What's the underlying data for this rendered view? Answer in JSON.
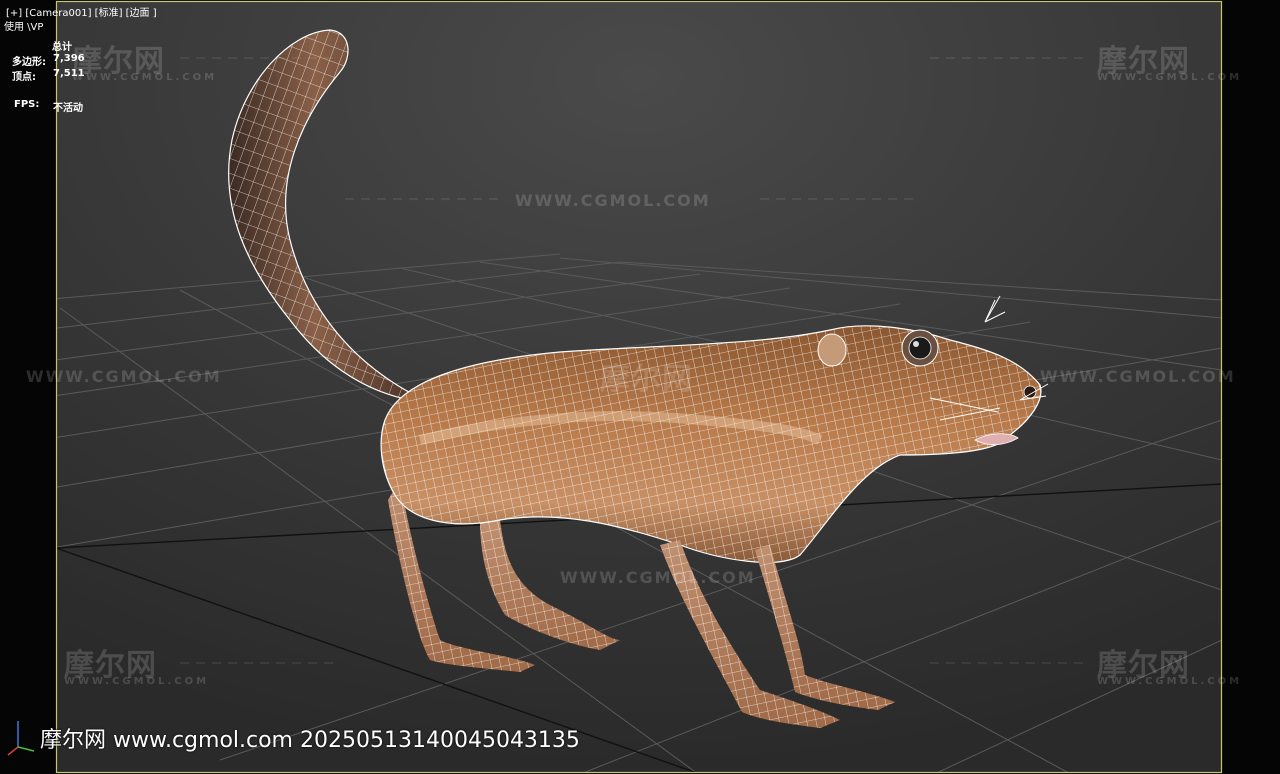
{
  "viewport": {
    "label_menu": "[+]  [Camera001]  [标准]  [边面 ]",
    "renderer_label": "使用 \\VP",
    "stats": {
      "header": "总计",
      "polygons_label": "多边形:",
      "polygons_value": "7,396",
      "vertices_label": "顶点:",
      "vertices_value": "7,511",
      "fps_label": "FPS:",
      "fps_value": "不活动"
    },
    "border_color": "#c8c860"
  },
  "watermarks": {
    "logo_text": "摩尔网",
    "url_text": "WWW.CGMOL.COM",
    "url_text_small": "WWW.CGMOL.COM"
  },
  "caption": {
    "text": "摩尔网  www.cgmol.com  20250513140045043135"
  },
  "model": {
    "subject": "3D low-poly animal (ground squirrel) in wireframe-on-shaded mode",
    "base_color": "#a0643a",
    "wire_color": "#ffffff"
  }
}
